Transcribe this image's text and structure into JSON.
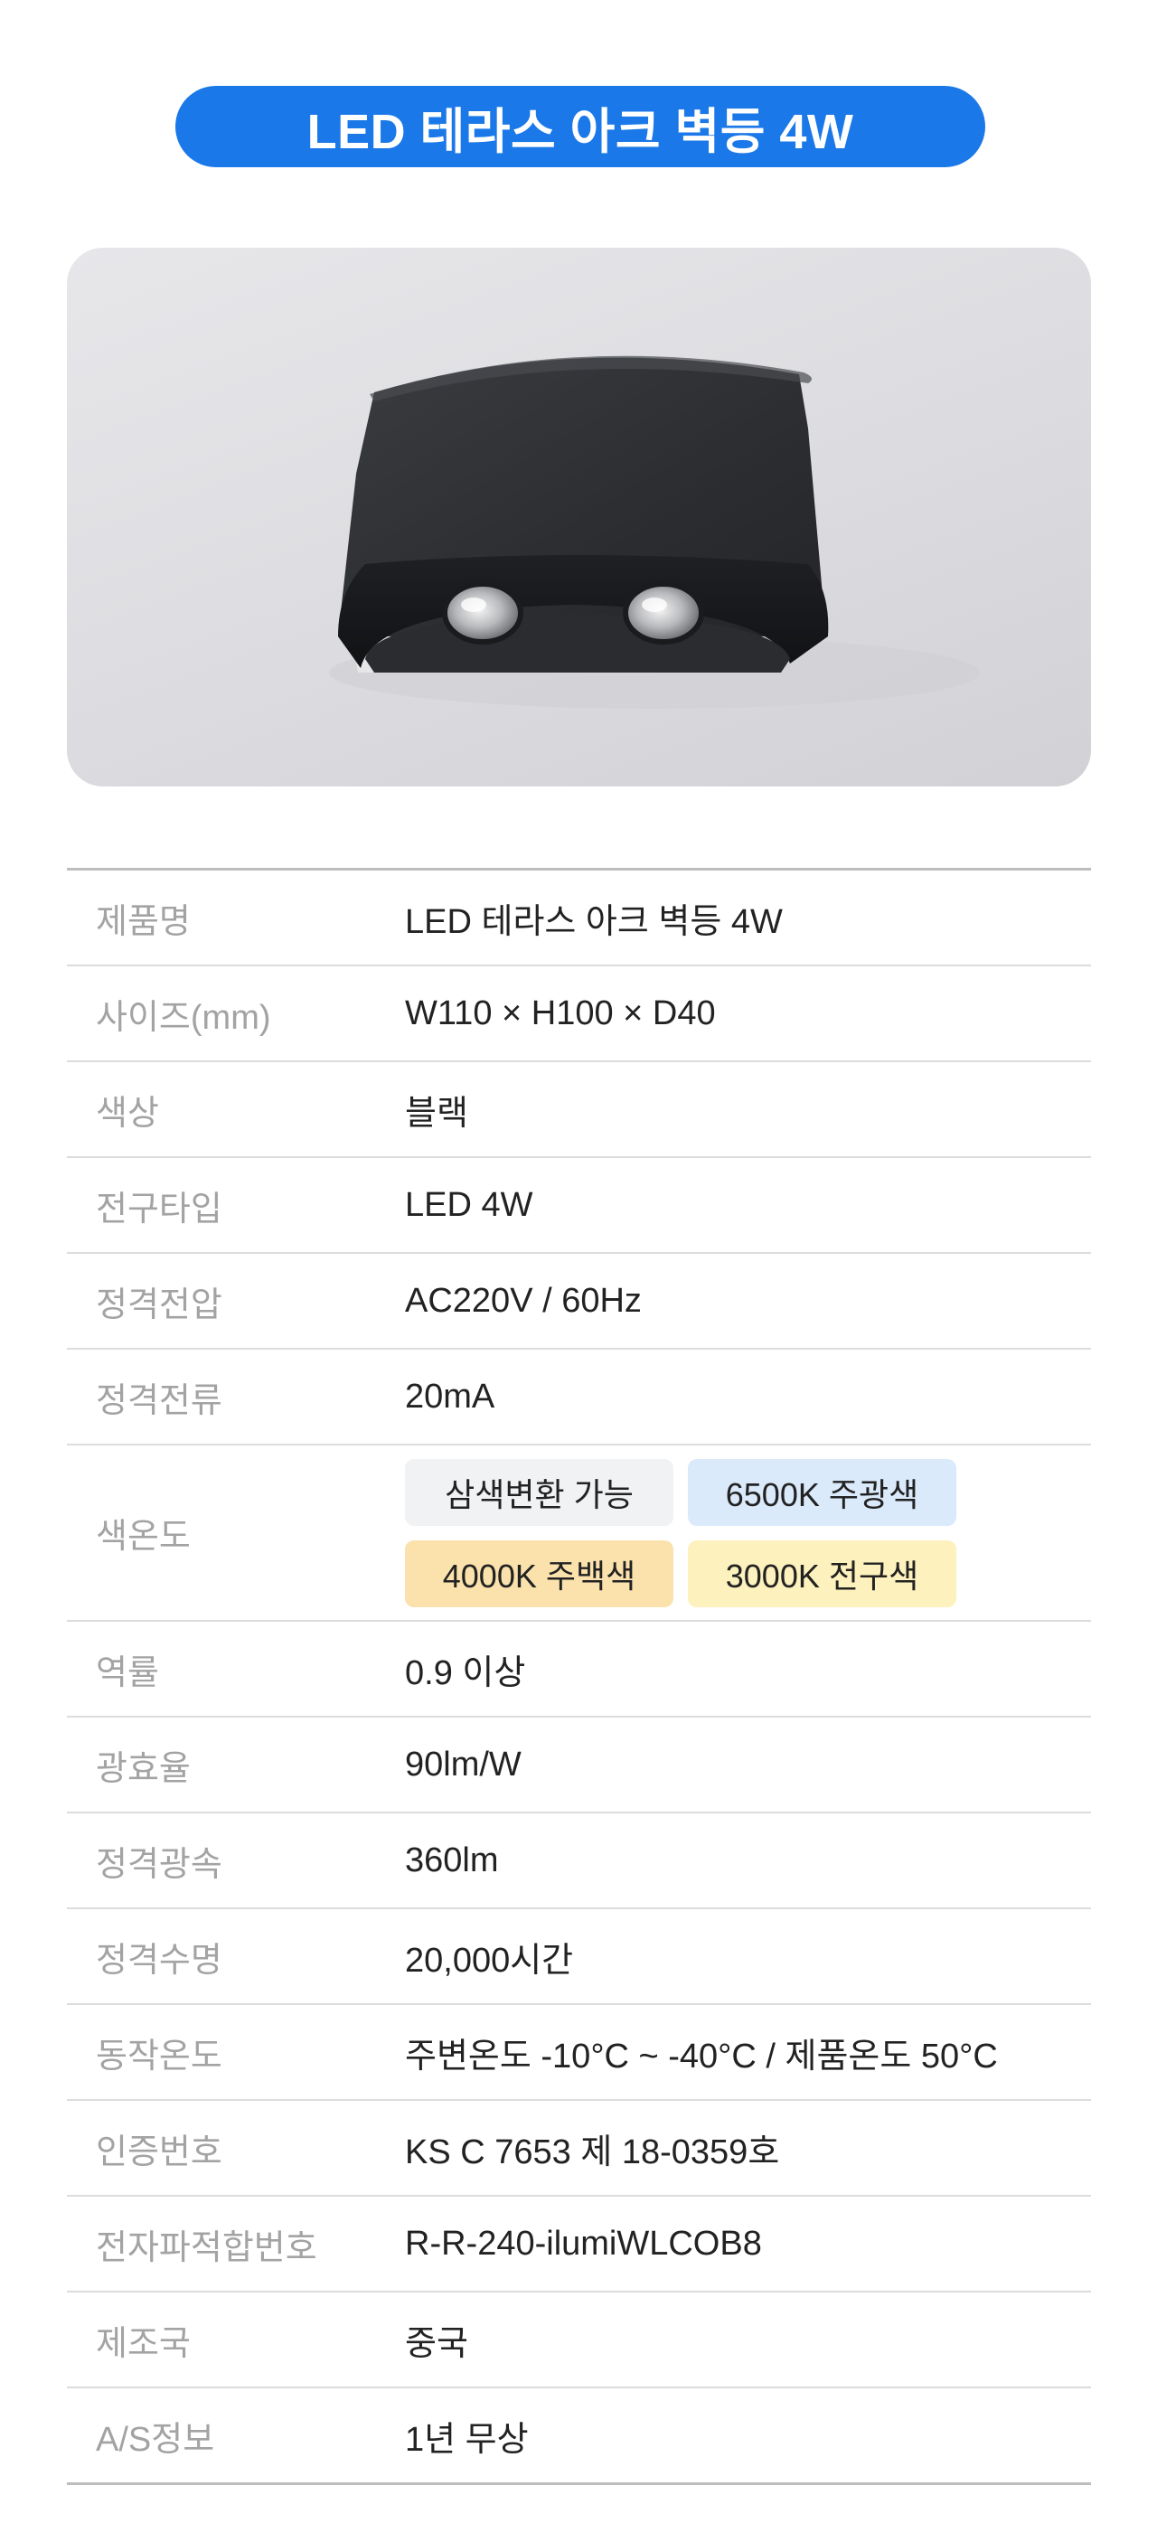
{
  "title": "LED 테라스 아크 벽등 4W",
  "specs": [
    {
      "label": "제품명",
      "value": "LED 테라스 아크 벽등 4W"
    },
    {
      "label": "사이즈(mm)",
      "value": "W110 × H100 × D40"
    },
    {
      "label": "색상",
      "value": "블랙"
    },
    {
      "label": "전구타입",
      "value": "LED 4W"
    },
    {
      "label": "정격전압",
      "value": "AC220V / 60Hz"
    },
    {
      "label": "정격전류",
      "value": "20mA"
    },
    {
      "label": "색온도"
    },
    {
      "label": "역률",
      "value": "0.9 이상"
    },
    {
      "label": "광효율",
      "value": "90lm/W"
    },
    {
      "label": "정격광속",
      "value": "360lm"
    },
    {
      "label": "정격수명",
      "value": "20,000시간"
    },
    {
      "label": "동작온도",
      "value": "주변온도 -10°C ~ -40°C / 제품온도 50°C"
    },
    {
      "label": "인증번호",
      "value": "KS C 7653 제 18-0359호"
    },
    {
      "label": "전자파적합번호",
      "value": "R-R-240-ilumiWLCOB8"
    },
    {
      "label": "제조국",
      "value": "중국"
    },
    {
      "label": "A/S정보",
      "value": "1년 무상"
    }
  ],
  "color_temp_chips": [
    {
      "text": "삼색변환 가능",
      "color": "#f1f2f4"
    },
    {
      "text": "6500K 주광색",
      "color": "#dbeafb"
    },
    {
      "text": "4000K 주백색",
      "color": "#fbe2ad"
    },
    {
      "text": "3000K 전구색",
      "color": "#fdf1bd"
    }
  ],
  "colors": {
    "title_bg": "#1a78e8",
    "label_text": "#a3a3a3",
    "value_text": "#222222"
  },
  "image": {
    "subject": "black arc LED wall lamp with two lenses"
  }
}
